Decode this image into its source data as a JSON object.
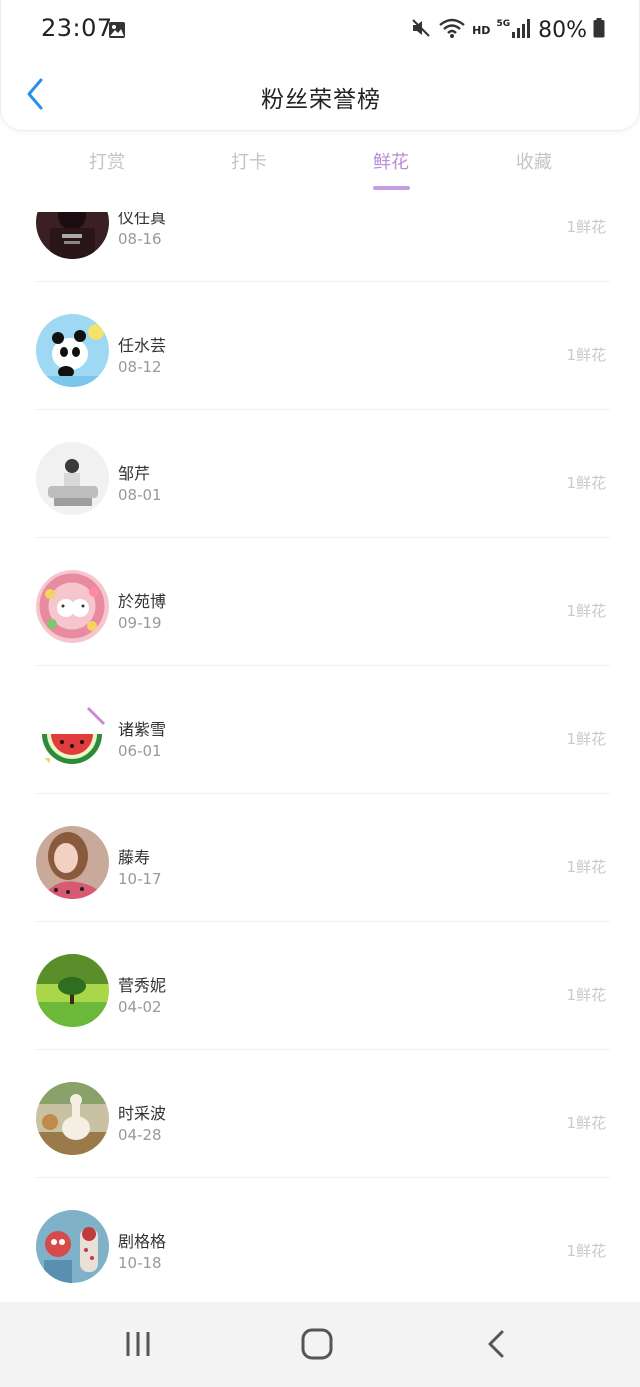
{
  "status_bar": {
    "time": "23:07",
    "network_label": "HD",
    "signal_label": "5G",
    "battery": "80%"
  },
  "header": {
    "title": "粉丝荣誉榜"
  },
  "tabs": [
    {
      "label": "打赏"
    },
    {
      "label": "打卡"
    },
    {
      "label": "鲜花"
    },
    {
      "label": "收藏"
    }
  ],
  "active_tab": "鲜花",
  "accent_color": "#b88ad8",
  "fans": [
    {
      "name": "仪任真",
      "date": "08-16",
      "count": "1鲜花",
      "avatar": "dark-portrait"
    },
    {
      "name": "任水芸",
      "date": "08-12",
      "count": "1鲜花",
      "avatar": "panda"
    },
    {
      "name": "邹芹",
      "date": "08-01",
      "count": "1鲜花",
      "avatar": "person-sketch"
    },
    {
      "name": "於苑博",
      "date": "09-19",
      "count": "1鲜花",
      "avatar": "flower-wreath"
    },
    {
      "name": "诸紫雪",
      "date": "06-01",
      "count": "1鲜花",
      "avatar": "watermelon"
    },
    {
      "name": "藤寿",
      "date": "10-17",
      "count": "1鲜花",
      "avatar": "woman-portrait"
    },
    {
      "name": "菅秀妮",
      "date": "04-02",
      "count": "1鲜花",
      "avatar": "green-tree"
    },
    {
      "name": "时采波",
      "date": "04-28",
      "count": "1鲜花",
      "avatar": "alpaca"
    },
    {
      "name": "剧格格",
      "date": "10-18",
      "count": "1鲜花",
      "avatar": "toy-figures"
    }
  ]
}
